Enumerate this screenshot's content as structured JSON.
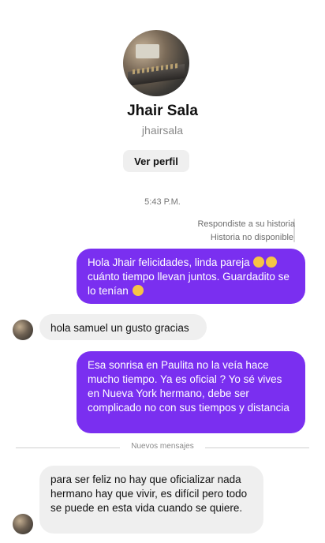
{
  "profile": {
    "name": "Jhair Sala",
    "handle": "jhairsala",
    "view_profile_label": "Ver perfil"
  },
  "chat": {
    "timestamp": "5:43 P.M.",
    "story_reply_note": "Respondiste a su historia",
    "story_unavailable": "Historia no disponible",
    "messages": [
      {
        "direction": "outgoing",
        "text": "Hola Jhair felicidades, linda pareja",
        "text_2": "cuánto tiempo llevan juntos. Guardadito se lo tenían"
      },
      {
        "direction": "incoming",
        "text": "hola samuel un gusto gracias"
      },
      {
        "direction": "outgoing",
        "text": "Esa sonrisa en Paulita no la veía hace mucho tiempo. Ya es oficial ? Yo sé vives en Nueva York hermano, debe ser complicado no con sus tiempos y distancia"
      },
      {
        "direction": "incoming",
        "text": "para ser feliz no hay que oficializar nada hermano hay que vivir, es difícil pero todo se puede en esta vida cuando se quiere."
      }
    ],
    "new_messages_divider": "Nuevos mensajes"
  },
  "colors": {
    "outgoing_bubble": "#7a2ff0",
    "incoming_bubble": "#efefef"
  }
}
